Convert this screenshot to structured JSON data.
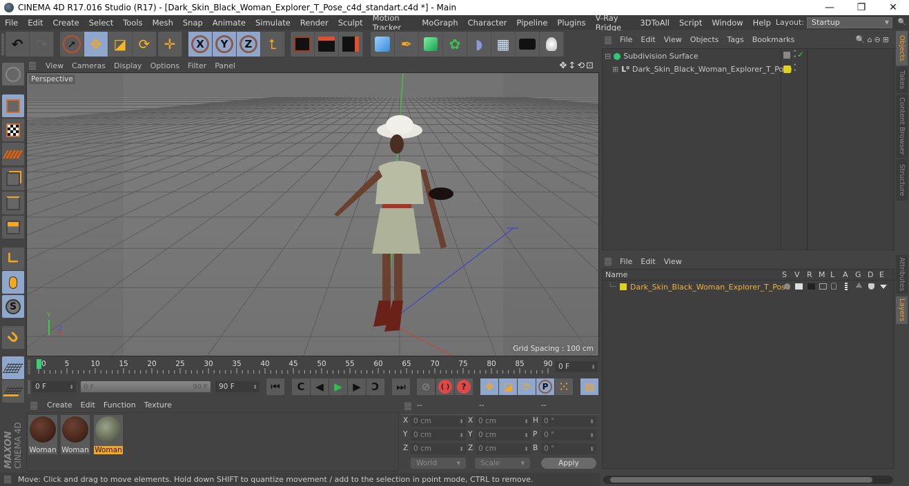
{
  "window": {
    "title": "CINEMA 4D R17.016 Studio (R17) - [Dark_Skin_Black_Woman_Explorer_T_Pose_c4d_standart.c4d *] - Main",
    "minimize": "—",
    "restore": "❐",
    "close": "✕"
  },
  "menubar": {
    "items": [
      "File",
      "Edit",
      "Create",
      "Select",
      "Tools",
      "Mesh",
      "Snap",
      "Animate",
      "Simulate",
      "Render",
      "Sculpt",
      "Motion Tracker",
      "MoGraph",
      "Character",
      "Pipeline",
      "Plugins",
      "V-Ray Bridge",
      "3DToAll",
      "Script",
      "Window",
      "Help"
    ],
    "layout_label": "Layout:",
    "layout_value": "Startup",
    "search_icon": "🔍"
  },
  "toolbar": {
    "undo": "↶",
    "redo": "↷",
    "select": "➚",
    "move": "✥",
    "scale": "◪",
    "rotate": "⟳",
    "last_tool": "✛",
    "x_axis": "X",
    "y_axis": "Y",
    "z_axis": "Z",
    "coord_system": "⮤",
    "render_view": "🎬",
    "render_picture": "🎬",
    "render_settings": "⚙",
    "cube": "⬢",
    "pen": "✒",
    "subdivision": "⬡",
    "cloner": "✿",
    "deformer": "◗",
    "floor": "▦",
    "camera": "🎥",
    "light": "💡"
  },
  "viewport": {
    "menu": [
      "View",
      "Cameras",
      "Display",
      "Options",
      "Filter",
      "Panel"
    ],
    "nav_icons": "✥↕⟲⊡",
    "camera_label": "Perspective",
    "grid_spacing": "Grid Spacing : 100 cm",
    "axis_y": "Y",
    "axis_x": "X",
    "axis_z": "Z"
  },
  "timeline": {
    "ticks": [
      "0",
      "5",
      "10",
      "15",
      "20",
      "25",
      "30",
      "35",
      "40",
      "45",
      "50",
      "55",
      "60",
      "65",
      "70",
      "75",
      "80",
      "85",
      "90"
    ],
    "current_frame": "0 F",
    "start_field": "0 F",
    "range_start": "0 F",
    "range_end": "90 F",
    "end_field": "90 F",
    "current_field": "0 F"
  },
  "playback": {
    "goto_start": "⏮",
    "prev_key": "C",
    "prev_frame": "◀",
    "play": "▶",
    "next_frame": "▶",
    "next_key": "C",
    "goto_end": "⏭",
    "record_disabled": "⊘",
    "record_auto": "( )",
    "keyframe_help": "?",
    "key_move": "✥",
    "key_scale": "◪",
    "key_rotate": "⟳",
    "key_param": "P",
    "key_pla": "⁙",
    "timeline_btn": "▤"
  },
  "materials": {
    "menu": [
      "Create",
      "Edit",
      "Function",
      "Texture"
    ],
    "items": [
      {
        "label": "Woman",
        "color": "#4a2a1a",
        "selected": false
      },
      {
        "label": "Woman",
        "color": "#4f2c1c",
        "selected": false
      },
      {
        "label": "Woman",
        "color": "#7d8a6a",
        "selected": true
      }
    ],
    "brand_top": "MAXON",
    "brand_bottom": "CINEMA 4D"
  },
  "coordinates": {
    "headers": [
      "--",
      "--",
      "--"
    ],
    "rows": [
      {
        "l1": "X",
        "v1": "0 cm",
        "l2": "X",
        "v2": "0 cm",
        "l3": "H",
        "v3": "0 °"
      },
      {
        "l1": "Y",
        "v1": "0 cm",
        "l2": "Y",
        "v2": "0 cm",
        "l3": "P",
        "v3": "0 °"
      },
      {
        "l1": "Z",
        "v1": "0 cm",
        "l2": "Z",
        "v2": "0 cm",
        "l3": "B",
        "v3": "0 °"
      }
    ],
    "mode": "World",
    "transform": "Scale",
    "apply": "Apply"
  },
  "status": {
    "text": "Move: Click and drag to move elements. Hold down SHIFT to quantize movement / add to the selection in point mode, CTRL to remove."
  },
  "object_manager": {
    "menu": [
      "File",
      "Edit",
      "View",
      "Objects",
      "Tags",
      "Bookmarks"
    ],
    "tool_icons": "🔍⌂⊖⊞",
    "objects": [
      {
        "name": "Subdivision Surface",
        "indent": 0,
        "expand": "⊟",
        "icon_color": "#2ecc71",
        "check": "✓"
      },
      {
        "name": "Dark_Skin_Black_Woman_Explorer_T_Pose",
        "indent": 1,
        "expand": "⊞",
        "icon": "L⁰",
        "tag_color": "#e0d020"
      }
    ]
  },
  "layer_manager": {
    "menu": [
      "File",
      "Edit",
      "View"
    ],
    "name_header": "Name",
    "columns": [
      "S",
      "V",
      "R",
      "M",
      "L",
      "A",
      "G",
      "D",
      "E"
    ],
    "layers": [
      {
        "name": "Dark_Skin_Black_Woman_Explorer_T_Pose",
        "color": "#e0d020"
      }
    ]
  },
  "side_tabs": {
    "top": [
      "Objects",
      "Takes",
      "Content Browser",
      "Structure"
    ],
    "bottom": [
      "Attributes",
      "Layers"
    ]
  },
  "colors": {
    "accent_orange": "#f5a623",
    "active_blue": "#8fa7cc",
    "layer_text": "#f0b040"
  }
}
